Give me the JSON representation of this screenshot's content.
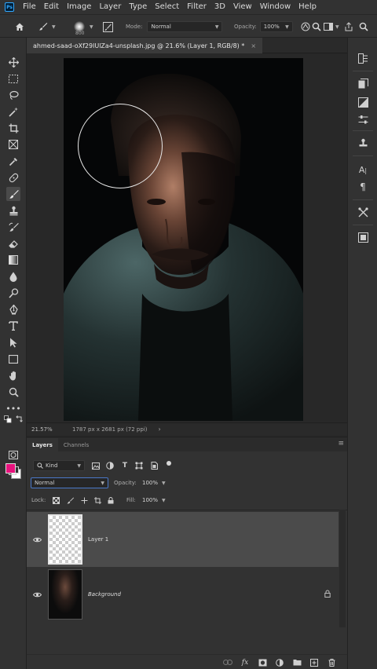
{
  "app": {
    "logo": "Ps"
  },
  "menu": [
    "File",
    "Edit",
    "Image",
    "Layer",
    "Type",
    "Select",
    "Filter",
    "3D",
    "View",
    "Window",
    "Help"
  ],
  "options": {
    "brush_size": "800",
    "mode_label": "Mode:",
    "mode_value": "Normal",
    "opacity_label": "Opacity:",
    "opacity_value": "100%"
  },
  "document": {
    "tab_title": "ahmed-saad-oXf29lUlZa4-unsplash.jpg @ 21.6% (Layer 1, RGB/8) *",
    "close_glyph": "×"
  },
  "status": {
    "zoom": "21.57%",
    "doc_info": "1787 px x 2681 px (72 ppi)",
    "arrow": "›"
  },
  "colors": {
    "foreground": "#e8127d",
    "background": "#ffffff"
  },
  "layers_panel": {
    "tabs": [
      "Layers",
      "Channels"
    ],
    "kind_label": "Kind",
    "blend_mode": "Normal",
    "opacity_label": "Opacity:",
    "opacity_value": "100%",
    "lock_label": "Lock:",
    "fill_label": "Fill:",
    "fill_value": "100%",
    "layers": [
      {
        "name": "Layer 1",
        "visible": true,
        "selected": true,
        "thumbnail": "transparent"
      },
      {
        "name": "Background",
        "visible": true,
        "selected": false,
        "thumbnail": "photo",
        "locked": true
      }
    ]
  }
}
